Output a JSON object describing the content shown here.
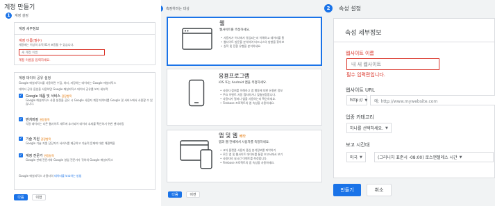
{
  "panel1": {
    "page_title": "계정 만들기",
    "step_number": "1",
    "step_label": "계정 설정",
    "account_card": {
      "heading": "계정 세부정보",
      "name_label": "계정 이름(필수)",
      "name_hint": "계정에는 이상의 추적 ID가 포함될 수 있습니다.",
      "name_placeholder": "새 계정 이름",
      "name_error": "계정 이름을 입력하세요."
    },
    "sharing_card": {
      "heading": "계정 데이터 공유 설정",
      "desc1": "Google 애널리틱스를 사용하면 수집, 처리, 저장하는 데이터는 Google 애널리틱스",
      "desc2": "데이터 공유 옵션을 사용하면 Google 애널리틱스 데이터 공유를 보다 세부적",
      "options": [
        {
          "title": "Google 제품 및 서비스",
          "rec": "권장항목",
          "desc": "Google 애널리틱스 사용 설정을 공유 시 Google 사용자 계정 데이터를 Google 및 서비스에서 사용할 수 있습니다."
        },
        {
          "title": "벤치마킹",
          "rec": "권장항목",
          "desc": "익명 데이터는 다른 웹사이트 세트에 추가되어 데이터 추세를 확인하기 위한 벤치마킹"
        },
        {
          "title": "기술 지원",
          "rec": "권장항목",
          "desc": "Google 기술 지원 담당자가 서비스를 제공하고 기술적 문제에 대한 해결책을"
        },
        {
          "title": "계정 전문가",
          "rec": "권장항목",
          "desc": "Google 판매 전문가와 Google 영업 전문가가 귀하의 Google 애널리틱스"
        }
      ],
      "footer_text": "Google 애널리틱스 사용자의",
      "footer_link": "데이터를 보호하는 방법"
    },
    "next_label": "다음",
    "prev_label": "이전"
  },
  "panel2": {
    "step_number": "2",
    "step_label": "측정하려는 대상",
    "targets": [
      {
        "title": "웹",
        "subtitle": "웹사이트를 측정하세요.",
        "bullets": [
          "사용자가 어디에서 유입되는지 이해하고 데이터를 통",
          "웹사이트 방문을 분석하여 비즈니스의 방향을 찾아보",
          "실적 및 전환 유형을 분석하세요."
        ]
      },
      {
        "title": "응용프로그램",
        "subtitle": "iOS 또는 Android 앱을 측정하세요.",
        "bullets": [
          "사용자 참여를 이해하고 앱 행동에 대한 유용한 정보",
          "주요 이벤트 자동 캡처하거나 맞춤설정합니다.",
          "사용자가 얼마나 앱을 사용하는지 확인하세요.",
          "Firebase 프로젝트의 앱 속성을 사용하세요."
        ]
      },
      {
        "title": "앱 및 웹",
        "badge": "베타",
        "subtitle": "앱과 웹 전체에서 사용자를 측정하세요.",
        "bullets": [
          "교차 플랫폼 사용자 중심 분석정보를 파악하기",
          "모든 앱 및 웹사이트 데이터를 통합 보고서에서 보기",
          "사용자의 실시간 이벤트를 측정합니다.",
          "Firebase 프로젝트의 앱 속성을 사용하세요."
        ]
      }
    ],
    "next_label": "다음",
    "prev_label": "이전"
  },
  "panel3": {
    "step_number": "2",
    "step_label": "속성 설정",
    "card_heading": "속성 세부정보",
    "site_name_label": "웹사이트 이름",
    "site_name_placeholder": "내 새 웹사이트",
    "site_name_error": "필수 입력란입니다.",
    "url_label": "웹사이트 URL",
    "protocol_value": "http://",
    "url_placeholder": "예: http://www.mywebsite.com",
    "category_label": "업종 카테고리",
    "category_value": "하나를 선택하세요.",
    "timezone_label": "보고 시간대",
    "country_value": "미국",
    "timezone_value": "(그리니치 표준시 -08:00) 로스앤젤레스 시간",
    "create_label": "만들기",
    "cancel_label": "취소"
  },
  "colors": {
    "primary": "#1a73e8",
    "error": "#d93025",
    "recommend": "#e37400"
  }
}
